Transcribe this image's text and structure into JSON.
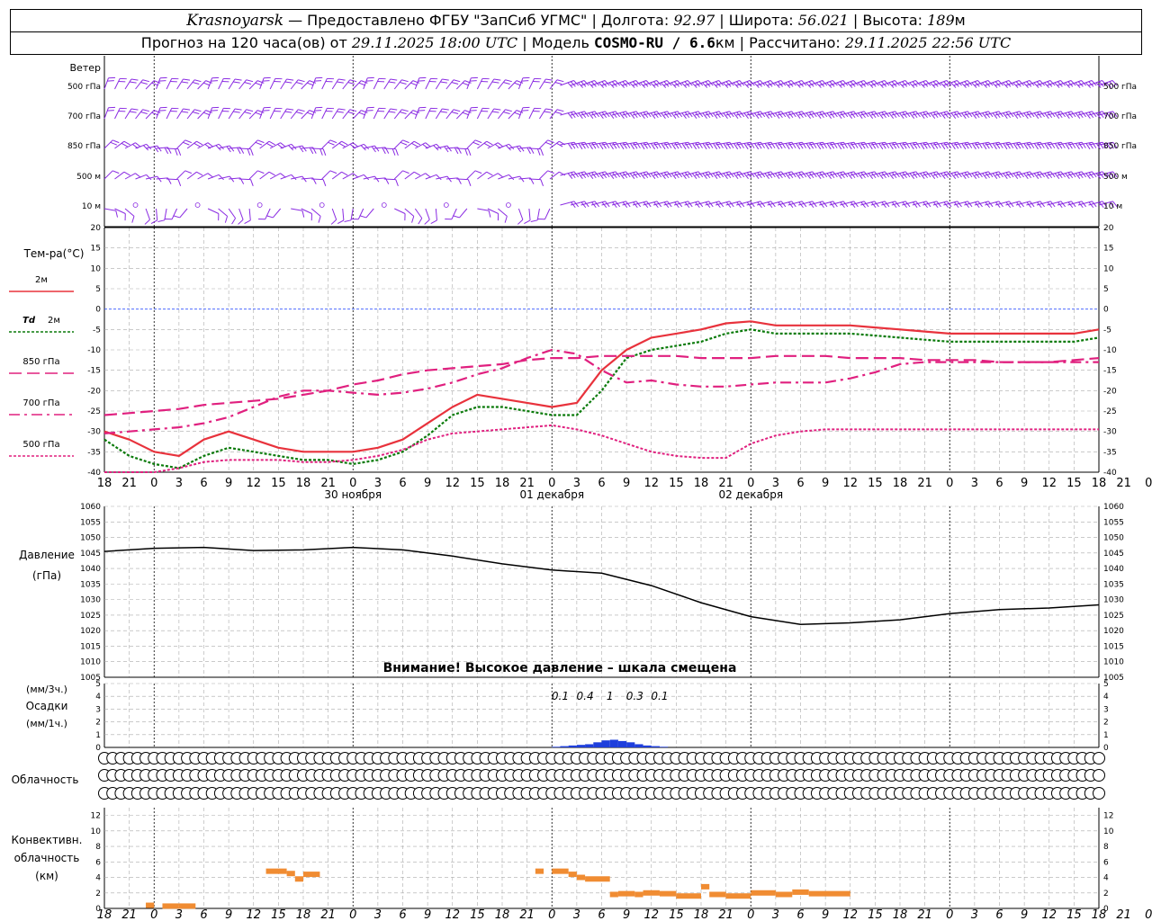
{
  "header": {
    "city": "Krasnoyarsk",
    "provider": "— Предоставлено ФГБУ \"ЗапСиб УГМС\" |",
    "lon_label": "Долгота:",
    "lon_value": "92.97",
    "lat_label": "| Широта:",
    "lat_value": "56.021",
    "alt_label": "| Высота:",
    "alt_value": "189",
    "alt_unit": "м",
    "forecast_label": "Прогноз на 120 часа(ов) от",
    "forecast_time": "29.11.2025 18:00 UTC",
    "model_label": "| Модель",
    "model_value": "COSMO-RU / 6.6",
    "model_unit": "км",
    "computed_label": "| Рассчитано:",
    "computed_time": "29.11.2025 22:56 UTC"
  },
  "colors": {
    "wind": "#8a2be2",
    "t2m": "#e8323c",
    "td2m": "#0a7a0a",
    "t850": "#e0207f",
    "t700": "#e0207f",
    "t500": "#e0207f",
    "zero_line": "#3355ff",
    "pressure": "#000000",
    "precip": "#1f3fdc",
    "convective": "#f08c32",
    "grid": "#aaaaaa"
  },
  "labels": {
    "wind": "Ветер",
    "levels": [
      "500 гПа",
      "700 гПа",
      "850 гПа",
      "500 м",
      "10 м"
    ],
    "temp_title": "Тем-ра(°C)",
    "temp_legend": [
      "2м",
      "2м",
      "850 гПа",
      "700 гПа",
      "500 гПа"
    ],
    "td_prefix": "Td",
    "dates": [
      "30 ноября",
      "01 декабря",
      "02 декабря"
    ],
    "pressure_line1": "Давление",
    "pressure_line2": "(гПа)",
    "warning": "Внимание! Высокое давление – шкала смещена",
    "precip_line1": "(мм/3ч.)",
    "precip_line2": "Осадки",
    "precip_line3": "(мм/1ч.)",
    "cloud": "Облачность",
    "conv_line1": "Конвективн.",
    "conv_line2": "облачность",
    "conv_line3": "(км)"
  },
  "chart_data": [
    {
      "type": "wind-barbs",
      "levels": [
        "500 гПа",
        "700 гПа",
        "850 гПа",
        "500 м",
        "10 м"
      ]
    },
    {
      "type": "line",
      "ylim": [
        -40,
        20
      ],
      "yticks": [
        -40,
        -35,
        -30,
        -25,
        -20,
        -15,
        -10,
        -5,
        0,
        5,
        10,
        15,
        20
      ],
      "x_hours": [
        0,
        3,
        6,
        9,
        12,
        15,
        18,
        21,
        24,
        27,
        30,
        33,
        36,
        39,
        42,
        45,
        48,
        51,
        54,
        57,
        60,
        63,
        66,
        69,
        72,
        75,
        78,
        81,
        84,
        87,
        90,
        93,
        96,
        99,
        102,
        105,
        108,
        111,
        114,
        117,
        120
      ],
      "xtick_labels": [
        "18",
        "21",
        "0",
        "3",
        "6",
        "9",
        "12",
        "15",
        "18",
        "21",
        "0",
        "3",
        "6",
        "9",
        "12",
        "15",
        "18",
        "21",
        "0",
        "3",
        "6",
        "9",
        "12",
        "15",
        "18",
        "21",
        "0",
        "3",
        "6",
        "9",
        "12",
        "15",
        "18",
        "21",
        "0",
        "3",
        "6",
        "9",
        "12",
        "15",
        "18",
        "21",
        "0"
      ],
      "series": [
        {
          "key": "t2m",
          "values": [
            -30,
            -32,
            -35,
            -36,
            -32,
            -30,
            -32,
            -34,
            -35,
            -35,
            -35,
            -34,
            -32,
            -28,
            -24,
            -21,
            -22,
            -23,
            -24,
            -23,
            -15,
            -10,
            -7,
            -6,
            -5,
            -3.5,
            -3,
            -4,
            -4,
            -4,
            -4,
            -4.5,
            -5,
            -5.5,
            -6,
            -6,
            -6,
            -6,
            -6,
            -6,
            -5
          ]
        },
        {
          "key": "td2m",
          "values": [
            -32,
            -36,
            -38,
            -39,
            -36,
            -34,
            -35,
            -36,
            -37,
            -37,
            -38,
            -37,
            -35,
            -31,
            -26,
            -24,
            -24,
            -25,
            -26,
            -26,
            -20,
            -12,
            -10,
            -9,
            -8,
            -6,
            -5,
            -6,
            -6,
            -6,
            -6,
            -6.5,
            -7,
            -7.5,
            -8,
            -8,
            -8,
            -8,
            -8,
            -8,
            -7
          ]
        },
        {
          "key": "t850",
          "values": [
            -26,
            -25.5,
            -25,
            -24.5,
            -23.5,
            -23,
            -22.5,
            -22,
            -21,
            -20,
            -18.5,
            -17.5,
            -16,
            -15,
            -14.5,
            -14,
            -13.5,
            -12.5,
            -12,
            -12,
            -11.5,
            -11.5,
            -11.5,
            -11.5,
            -12,
            -12,
            -12,
            -11.5,
            -11.5,
            -11.5,
            -12,
            -12,
            -12,
            -12.5,
            -12.5,
            -12.5,
            -13,
            -13,
            -13,
            -12.5,
            -12
          ]
        },
        {
          "key": "t700",
          "values": [
            -30.5,
            -30,
            -29.5,
            -29,
            -28,
            -26.5,
            -24,
            -21.5,
            -20,
            -20,
            -20.5,
            -21,
            -20.5,
            -19.5,
            -18,
            -16,
            -14.5,
            -12,
            -10,
            -11,
            -15,
            -18,
            -17.5,
            -18.5,
            -19,
            -19,
            -18.5,
            -18,
            -18,
            -18,
            -17,
            -15.5,
            -13.5,
            -13,
            -13,
            -13,
            -13,
            -13,
            -13,
            -13,
            -13
          ]
        },
        {
          "key": "t500",
          "values": [
            -41,
            -40.5,
            -40,
            -39,
            -37.5,
            -37,
            -37,
            -37,
            -37.5,
            -37.5,
            -37,
            -36,
            -34.5,
            -32,
            -30.5,
            -30,
            -29.5,
            -29,
            -28.5,
            -29.5,
            -31,
            -33,
            -35,
            -36,
            -36.5,
            -36.5,
            -33,
            -31,
            -30,
            -29.5,
            -29.5,
            -29.5,
            -29.5,
            -29.5,
            -29.5,
            -29.5,
            -29.5,
            -29.5,
            -29.5,
            -29.5,
            -29.5
          ]
        }
      ]
    },
    {
      "type": "line",
      "ylim": [
        1005,
        1060
      ],
      "yticks": [
        1005,
        1010,
        1015,
        1020,
        1025,
        1030,
        1035,
        1040,
        1045,
        1050,
        1055,
        1060
      ],
      "x_hours": [
        0,
        6,
        12,
        18,
        24,
        30,
        36,
        42,
        48,
        54,
        60,
        66,
        72,
        78,
        84,
        90,
        96,
        102,
        108,
        114,
        120
      ],
      "series": [
        {
          "key": "pressure",
          "values": [
            1045.5,
            1046.5,
            1046.8,
            1045.8,
            1046,
            1046.8,
            1046,
            1044,
            1041.5,
            1039.5,
            1038.5,
            1034.5,
            1029,
            1024.5,
            1022,
            1022.5,
            1023.5,
            1025.5,
            1026.8,
            1027.3,
            1028.3
          ]
        }
      ]
    },
    {
      "type": "bar",
      "ylim": [
        0,
        5
      ],
      "yticks": [
        0,
        1,
        2,
        3,
        4,
        5
      ],
      "labels_3h": [
        {
          "hour": 54,
          "text": "0.1"
        },
        {
          "hour": 57,
          "text": "0.4"
        },
        {
          "hour": 60,
          "text": "1"
        },
        {
          "hour": 63,
          "text": "0.3"
        },
        {
          "hour": 66,
          "text": "0.1"
        }
      ],
      "bars_1h": [
        {
          "hour": 54,
          "value": 0.05
        },
        {
          "hour": 55,
          "value": 0.1
        },
        {
          "hour": 56,
          "value": 0.15
        },
        {
          "hour": 57,
          "value": 0.2
        },
        {
          "hour": 58,
          "value": 0.25
        },
        {
          "hour": 59,
          "value": 0.4
        },
        {
          "hour": 60,
          "value": 0.55
        },
        {
          "hour": 61,
          "value": 0.6
        },
        {
          "hour": 62,
          "value": 0.5
        },
        {
          "hour": 63,
          "value": 0.4
        },
        {
          "hour": 64,
          "value": 0.25
        },
        {
          "hour": 65,
          "value": 0.15
        },
        {
          "hour": 66,
          "value": 0.1
        },
        {
          "hour": 67,
          "value": 0.05
        }
      ]
    },
    {
      "type": "table",
      "rows": [
        [
          0,
          0,
          0,
          0,
          0,
          0,
          0,
          0,
          0,
          0,
          0,
          0,
          0,
          0,
          0,
          0,
          0,
          0,
          0,
          0,
          0,
          0,
          0,
          0,
          0,
          0,
          0,
          0,
          0,
          0,
          0,
          0,
          0,
          0,
          0,
          0,
          0,
          0,
          0,
          0,
          0,
          0,
          0,
          0,
          0,
          0,
          0,
          0,
          0,
          0,
          0,
          0,
          0,
          0,
          0,
          0,
          0,
          0,
          0,
          0,
          0,
          0,
          0,
          0,
          0,
          0,
          0,
          0,
          0,
          0,
          0,
          0,
          0,
          0,
          0,
          0,
          0,
          0,
          0,
          0,
          0,
          0,
          0,
          0,
          0,
          0,
          0,
          0,
          0,
          0,
          0,
          0,
          0,
          0,
          0,
          0,
          0,
          0,
          0,
          0,
          0,
          0,
          0,
          0,
          0,
          0,
          0,
          0,
          0,
          0,
          0,
          0,
          0,
          0,
          0,
          0,
          0,
          0,
          0,
          0,
          0
        ],
        [
          0,
          0,
          0,
          0,
          0,
          0,
          0,
          0,
          0,
          0,
          0,
          0,
          0,
          0,
          0,
          0,
          0,
          0,
          0,
          0,
          0,
          0,
          0,
          0,
          0,
          0,
          0,
          0,
          0,
          0,
          0,
          0,
          0,
          0,
          0,
          0,
          0,
          0,
          0,
          0,
          0,
          0,
          0,
          0,
          0,
          0,
          0,
          0,
          0,
          0,
          0,
          0,
          0,
          0,
          0,
          0,
          0,
          0,
          0,
          0,
          0,
          0,
          0,
          0,
          0,
          0,
          0,
          0,
          0,
          0,
          0,
          0,
          0,
          0,
          0,
          0,
          0,
          0,
          0,
          0,
          0,
          0,
          0,
          0,
          0,
          0,
          0,
          0,
          0,
          0,
          0,
          0,
          0,
          0,
          0,
          0,
          0,
          0,
          0,
          0,
          0,
          0,
          0,
          0,
          0,
          0,
          0,
          0,
          0,
          0,
          0,
          0,
          0,
          0,
          0,
          0,
          0,
          0,
          0,
          0,
          0
        ],
        [
          0,
          0,
          0,
          0,
          0,
          0,
          0,
          0,
          0,
          0,
          0,
          0,
          0,
          0,
          0,
          0,
          0,
          0,
          0,
          0,
          0,
          0,
          0,
          0,
          0,
          0,
          0,
          0,
          0,
          0,
          0,
          0,
          0,
          0,
          0,
          0,
          0,
          0,
          0,
          0,
          0,
          0,
          0,
          0,
          0,
          0,
          0,
          0,
          0,
          0,
          0,
          0,
          0,
          0,
          0,
          0,
          0,
          0,
          0,
          0,
          0,
          0,
          0,
          0,
          0,
          0,
          0,
          0,
          0,
          0,
          0,
          0,
          0,
          0,
          0,
          0,
          0,
          0,
          0,
          0,
          0,
          0,
          0,
          0,
          0,
          0,
          0,
          0,
          0,
          0,
          0,
          0,
          0,
          0,
          0,
          0,
          0,
          0,
          0,
          0,
          0,
          0,
          0,
          0,
          0,
          0,
          0,
          0,
          0,
          0,
          0,
          0,
          0,
          0,
          0,
          0,
          0,
          0,
          0,
          0,
          0
        ]
      ]
    },
    {
      "type": "bar",
      "ylim": [
        0,
        13
      ],
      "yticks": [
        0,
        2,
        4,
        6,
        8,
        10,
        12
      ],
      "segments": [
        {
          "h0": 5,
          "h1": 6,
          "value": 0.4
        },
        {
          "h0": 7,
          "h1": 9,
          "value": 0.3
        },
        {
          "h0": 9,
          "h1": 11,
          "value": 0.3
        },
        {
          "h0": 19.5,
          "h1": 22,
          "value": 4.8
        },
        {
          "h0": 22,
          "h1": 23,
          "value": 4.5
        },
        {
          "h0": 23,
          "h1": 24,
          "value": 3.8
        },
        {
          "h0": 24,
          "h1": 26,
          "value": 4.4
        },
        {
          "h0": 52,
          "h1": 53,
          "value": 4.8
        },
        {
          "h0": 54,
          "h1": 56,
          "value": 4.8
        },
        {
          "h0": 56,
          "h1": 57,
          "value": 4.4
        },
        {
          "h0": 57,
          "h1": 58,
          "value": 4.0
        },
        {
          "h0": 58,
          "h1": 61,
          "value": 3.8
        },
        {
          "h0": 61,
          "h1": 62,
          "value": 1.8
        },
        {
          "h0": 62,
          "h1": 64,
          "value": 1.9
        },
        {
          "h0": 64,
          "h1": 65,
          "value": 1.8
        },
        {
          "h0": 65,
          "h1": 67,
          "value": 2.0
        },
        {
          "h0": 67,
          "h1": 69,
          "value": 1.9
        },
        {
          "h0": 69,
          "h1": 72,
          "value": 1.6
        },
        {
          "h0": 72,
          "h1": 73,
          "value": 2.8
        },
        {
          "h0": 73,
          "h1": 75,
          "value": 1.8
        },
        {
          "h0": 75,
          "h1": 78,
          "value": 1.6
        },
        {
          "h0": 78,
          "h1": 81,
          "value": 2.0
        },
        {
          "h0": 81,
          "h1": 83,
          "value": 1.8
        },
        {
          "h0": 83,
          "h1": 85,
          "value": 2.1
        },
        {
          "h0": 85,
          "h1": 90,
          "value": 1.9
        }
      ]
    }
  ]
}
